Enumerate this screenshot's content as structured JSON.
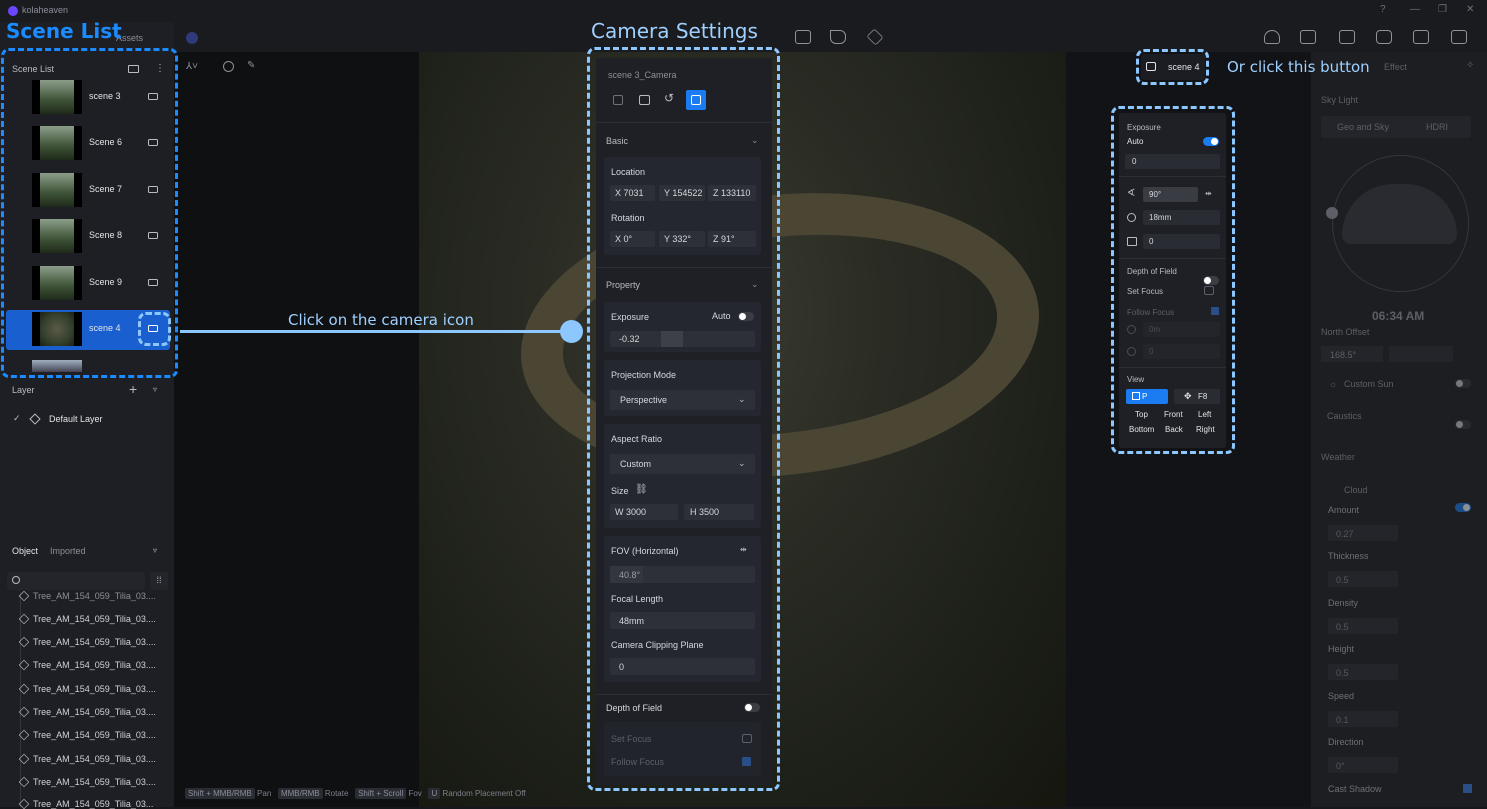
{
  "app": {
    "title": "kolaheaven"
  },
  "annotations": {
    "scene_list_title": "Scene List",
    "camera_settings_title": "Camera Settings",
    "click_camera_icon": "Click on the camera icon",
    "or_click_button": "Or click this button"
  },
  "left_tabs": {
    "assets": "Assets"
  },
  "scene_list": {
    "header": "Scene List",
    "items": [
      {
        "label": "scene 3"
      },
      {
        "label": "Scene 6"
      },
      {
        "label": "Scene 7"
      },
      {
        "label": "Scene 8"
      },
      {
        "label": "Scene 9"
      },
      {
        "label": "scene 4",
        "selected": true
      }
    ]
  },
  "layer": {
    "header": "Layer",
    "default": "Default Layer"
  },
  "object_panel": {
    "tab_object": "Object",
    "tab_imported": "Imported",
    "search_placeholder": "",
    "items": [
      "Tree_AM_154_059_Tilia_03....",
      "Tree_AM_154_059_Tilia_03....",
      "Tree_AM_154_059_Tilia_03....",
      "Tree_AM_154_059_Tilia_03....",
      "Tree_AM_154_059_Tilia_03....",
      "Tree_AM_154_059_Tilia_03....",
      "Tree_AM_154_059_Tilia_03....",
      "Tree_AM_154_059_Tilia_03....",
      "Tree_AM_154_059_Tilia_03....",
      "Tree_AM_154_059_Tilia_03....",
      "Tree_AM_154_059_Tilia_03..."
    ]
  },
  "camera": {
    "name": "scene 3_Camera",
    "basic": "Basic",
    "location_label": "Location",
    "location": {
      "x": "X  7031",
      "y": "Y  154522",
      "z": "Z  133110"
    },
    "rotation_label": "Rotation",
    "rotation": {
      "x": "X  0°",
      "y": "Y  332°",
      "z": "Z  91°"
    },
    "property": "Property",
    "exposure_label": "Exposure",
    "auto_label": "Auto",
    "exposure_value": "-0.32",
    "projection_label": "Projection Mode",
    "projection_value": "Perspective",
    "aspect_label": "Aspect Ratio",
    "aspect_value": "Custom",
    "size_label": "Size",
    "width": "W  3000",
    "height": "H  3500",
    "fov_label": "FOV (Horizontal)",
    "fov_value": "40.8°",
    "focal_label": "Focal Length",
    "focal_value": "48mm",
    "clip_label": "Camera Clipping Plane",
    "clip_value": "0",
    "dof_label": "Depth of Field",
    "set_focus": "Set Focus",
    "follow_focus": "Follow Focus"
  },
  "scene_button": {
    "label": "scene 4"
  },
  "view_panel": {
    "exposure": "Exposure",
    "auto": "Auto",
    "exposure_value": "0",
    "fov": "90°",
    "focal": "18mm",
    "clip": "0",
    "dof": "Depth of Field",
    "set_focus": "Set Focus",
    "follow_focus": "Follow Focus",
    "focus_dist": "0m",
    "aperture": "0",
    "view": "View",
    "p": "P",
    "f8": "F8",
    "top": "Top",
    "front": "Front",
    "left": "Left",
    "bottom": "Bottom",
    "back": "Back",
    "right": "Right"
  },
  "right_panel": {
    "effect_tab": "Effect",
    "sky_light": "Sky Light",
    "geo_sky": "Geo and Sky",
    "hdri": "HDRI",
    "time": "06:34 AM",
    "north_offset": "North Offset",
    "north_value": "168.5°",
    "custom_sun": "Custom Sun",
    "caustics": "Caustics",
    "weather": "Weather",
    "cloud": "Cloud",
    "amount": "Amount",
    "amount_v": "0.27",
    "thickness": "Thickness",
    "thickness_v": "0.5",
    "density": "Density",
    "density_v": "0.5",
    "height": "Height",
    "height_v": "0.5",
    "speed": "Speed",
    "speed_v": "0.1",
    "direction": "Direction",
    "direction_v": "0°",
    "cast_shadow": "Cast Shadow"
  },
  "hints": {
    "k1": "Shift + MMB/RMB",
    "t1": "Pan",
    "k2": "MMB/RMB",
    "t2": "Rotate",
    "k3": "Shift + Scroll",
    "t3": "Fov",
    "k4": "U",
    "t4": "Random Placement Off"
  },
  "colors": {
    "accent": "#1a7cf0",
    "annotation_dash": "#8cc8ff",
    "annotation_blue": "#1a8cff"
  }
}
